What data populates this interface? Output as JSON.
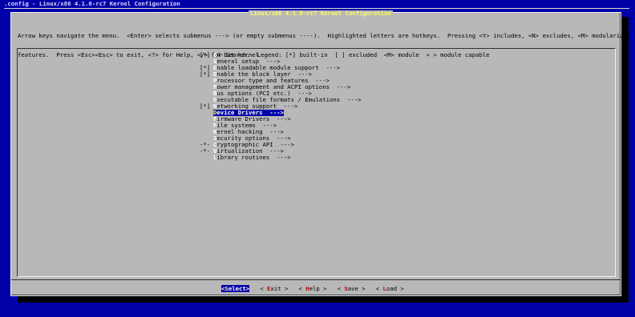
{
  "window": {
    "title": ".config - Linux/x86 4.1.0-rc7 Kernel Configuration"
  },
  "dialog": {
    "title": "Linux/x86 4.1.0-rc7 Kernel Configuration",
    "help_line_1": "Arrow keys navigate the menu.  <Enter> selects submenus ---> (or empty submenus ----).  Highlighted letters are hotkeys.  Pressing <Y> includes, <N> excludes, <M> modularizes",
    "help_line_2": "features.  Press <Esc><Esc> to exit, <?> for Help, </> for Search.  Legend: [*] built-in  [ ] excluded  <M> module  < > module capable"
  },
  "menu": {
    "items": [
      {
        "prefix": "[*]",
        "hotkey": "6",
        "rest": "4-bit kernel"
      },
      {
        "prefix": "",
        "hotkey": "G",
        "rest": "eneral setup  --->"
      },
      {
        "prefix": "[*]",
        "hotkey": "E",
        "rest": "nable loadable module support  --->"
      },
      {
        "prefix": "[*]",
        "hotkey": "E",
        "rest": "nable the block layer  --->"
      },
      {
        "prefix": "",
        "hotkey": "P",
        "rest": "rocessor type and features  --->"
      },
      {
        "prefix": "",
        "hotkey": "P",
        "rest": "ower management and ACPI options  --->"
      },
      {
        "prefix": "",
        "hotkey": "B",
        "rest": "us options (PCI etc.)  --->"
      },
      {
        "prefix": "",
        "hotkey": "E",
        "rest": "xecutable file formats / Emulations  --->"
      },
      {
        "prefix": "[*]",
        "hotkey": "N",
        "rest": "etworking support  --->"
      },
      {
        "prefix": "",
        "hotkey": "D",
        "rest": "evice Drivers  --->",
        "selected": true
      },
      {
        "prefix": "",
        "hotkey": "F",
        "rest": "irmware Drivers  --->"
      },
      {
        "prefix": "",
        "hotkey": "F",
        "rest": "ile systems  --->"
      },
      {
        "prefix": "",
        "hotkey": "K",
        "rest": "ernel hacking  --->"
      },
      {
        "prefix": "",
        "hotkey": "S",
        "rest": "ecurity options  --->"
      },
      {
        "prefix": "-*-",
        "hotkey": "C",
        "rest": "ryptographic API  --->"
      },
      {
        "prefix": "-*-",
        "hotkey": "V",
        "rest": "irtualization  --->"
      },
      {
        "prefix": "",
        "hotkey": "L",
        "rest": "ibrary routines  --->"
      }
    ]
  },
  "buttons": [
    {
      "left": "<",
      "hotkey": "S",
      "rest": "elect",
      "right": ">",
      "primary": true
    },
    {
      "left": "< ",
      "hotkey": "E",
      "rest": "xit",
      "right": " >",
      "primary": false
    },
    {
      "left": "< ",
      "hotkey": "H",
      "rest": "elp",
      "right": " >",
      "primary": false
    },
    {
      "left": "< ",
      "hotkey": "S",
      "rest": "ave",
      "right": " >",
      "primary": false
    },
    {
      "left": "< ",
      "hotkey": "L",
      "rest": "oad",
      "right": " >",
      "primary": false
    }
  ],
  "colors": {
    "background": "#0000a8",
    "dialog": "#b8b8b8",
    "title_hot": "#ffff54",
    "menu_hotkey": "#ffffff",
    "button_hotkey": "#cc0000"
  }
}
